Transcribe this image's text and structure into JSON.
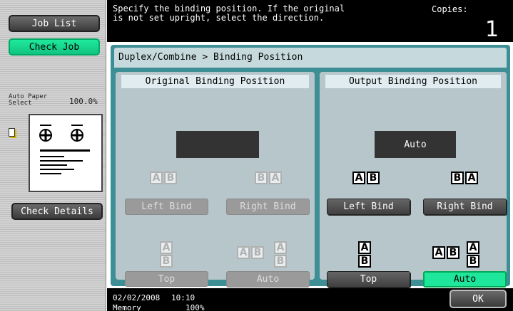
{
  "sidebar": {
    "job_list": "Job List",
    "check_job": "Check Job",
    "auto_paper_line1": "Auto Paper",
    "auto_paper_line2": "Select",
    "zoom": "100.0%",
    "check_details": "Check Details"
  },
  "header": {
    "message": "Specify the binding position. If the original\nis not set upright, select the direction.",
    "copies_label": "Copies:",
    "copies_value": "1"
  },
  "panel": {
    "breadcrumb": "Duplex/Combine > Binding Position",
    "original": {
      "title": "Original Binding Position",
      "display_value": "",
      "left_bind": "Left Bind",
      "right_bind": "Right Bind",
      "top": "Top",
      "auto": "Auto"
    },
    "output": {
      "title": "Output Binding Position",
      "display_value": "Auto",
      "left_bind": "Left Bind",
      "right_bind": "Right Bind",
      "top": "Top",
      "auto": "Auto",
      "selected": "Auto"
    }
  },
  "glyphs": {
    "a": "A",
    "b": "B"
  },
  "footer": {
    "date": "02/02/2008",
    "time": "10:10",
    "memory_label": "Memory",
    "memory_value": "100%",
    "ok": "OK"
  },
  "colors": {
    "panel_bg": "#3d8f95",
    "selected_green": "#1ee69b",
    "disabled_gray": "#9a9a9a"
  }
}
